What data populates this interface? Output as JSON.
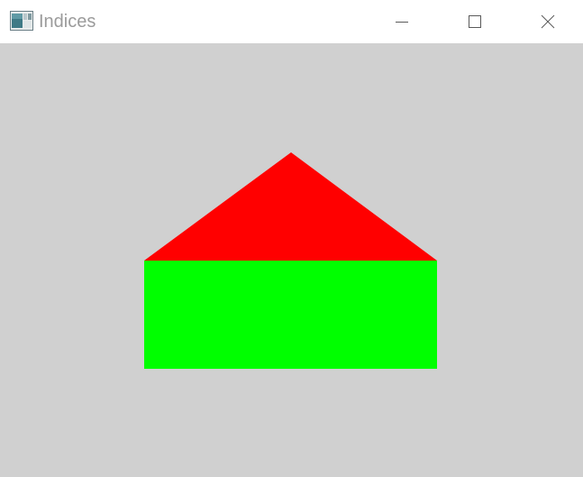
{
  "window": {
    "title": "Indices",
    "controls": {
      "minimize": "minimize-icon",
      "maximize": "maximize-icon",
      "close": "close-icon"
    }
  },
  "canvas": {
    "background_color": "#d0d0d0",
    "shapes": {
      "triangle": {
        "fill": "#ff0000"
      },
      "rectangle": {
        "fill": "#00ff00"
      }
    }
  }
}
